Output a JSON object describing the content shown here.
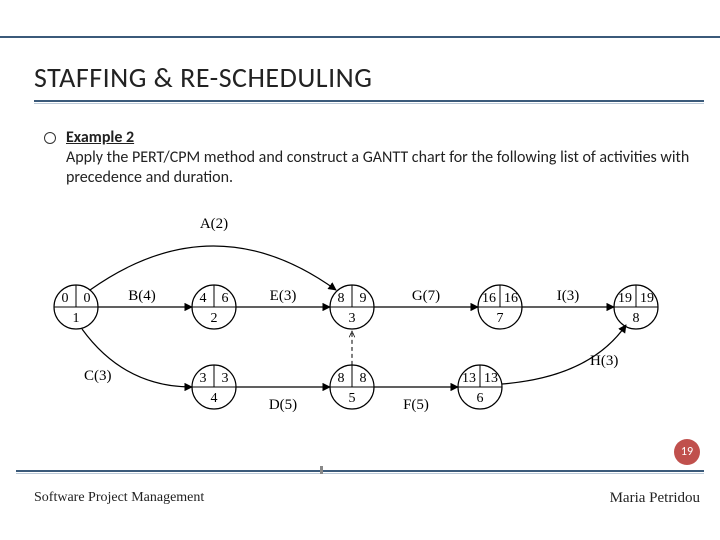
{
  "title": "STAFFING & RE-SCHEDULING",
  "example_title": "Example 2",
  "body_text": "Apply the PERT/CPM method and construct a GANTT chart for the following list of activities with precedence and duration.",
  "page_number": "19",
  "footer_left": "Software Project Management",
  "footer_right": "Maria Petridou",
  "nodes": {
    "n1": {
      "id": "1",
      "es": "0",
      "ef": "0"
    },
    "n2": {
      "id": "2",
      "es": "4",
      "ef": "6"
    },
    "n3": {
      "id": "3",
      "es": "8",
      "ef": "9"
    },
    "n4": {
      "id": "4",
      "es": "3",
      "ef": "3"
    },
    "n5": {
      "id": "5",
      "es": "8",
      "ef": "8"
    },
    "n6": {
      "id": "6",
      "es": "13",
      "ef": "13"
    },
    "n7": {
      "id": "7",
      "es": "16",
      "ef": "16"
    },
    "n8": {
      "id": "8",
      "es": "19",
      "ef": "19"
    }
  },
  "edges": {
    "A": "A(2)",
    "B": "B(4)",
    "C": "C(3)",
    "D": "D(5)",
    "E": "E(3)",
    "F": "F(5)",
    "G": "G(7)",
    "H": "H(3)",
    "I": "I(3)"
  },
  "chart_data": {
    "type": "table",
    "title": "PERT/CPM activity network",
    "nodes": [
      {
        "id": 1,
        "es": 0,
        "lf": 0
      },
      {
        "id": 2,
        "es": 4,
        "lf": 6
      },
      {
        "id": 3,
        "es": 8,
        "lf": 9
      },
      {
        "id": 4,
        "es": 3,
        "lf": 3
      },
      {
        "id": 5,
        "es": 8,
        "lf": 8
      },
      {
        "id": 6,
        "es": 13,
        "lf": 13
      },
      {
        "id": 7,
        "es": 16,
        "lf": 16
      },
      {
        "id": 8,
        "es": 19,
        "lf": 19
      }
    ],
    "edges": [
      {
        "name": "A",
        "from": 1,
        "to": 3,
        "duration": 2
      },
      {
        "name": "B",
        "from": 1,
        "to": 2,
        "duration": 4
      },
      {
        "name": "C",
        "from": 1,
        "to": 4,
        "duration": 3
      },
      {
        "name": "D",
        "from": 4,
        "to": 5,
        "duration": 5
      },
      {
        "name": "E",
        "from": 2,
        "to": 3,
        "duration": 3
      },
      {
        "name": "F",
        "from": 5,
        "to": 6,
        "duration": 5
      },
      {
        "name": "G",
        "from": 3,
        "to": 7,
        "duration": 7
      },
      {
        "name": "H",
        "from": 6,
        "to": 8,
        "duration": 3
      },
      {
        "name": "I",
        "from": 7,
        "to": 8,
        "duration": 3
      },
      {
        "name": "dummy",
        "from": 5,
        "to": 3,
        "duration": 0,
        "dashed": true
      }
    ]
  }
}
